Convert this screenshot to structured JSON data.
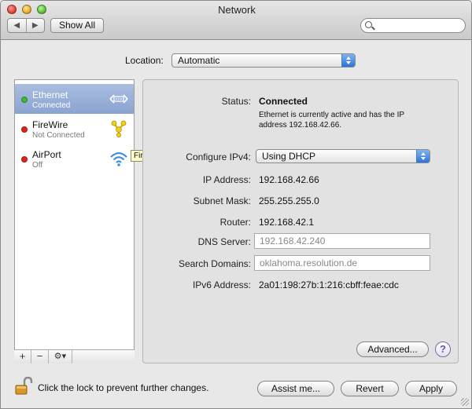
{
  "window": {
    "title": "Network"
  },
  "toolbar": {
    "back": "◀",
    "forward": "▶",
    "show_all": "Show All",
    "search_placeholder": ""
  },
  "location": {
    "label": "Location:",
    "value": "Automatic"
  },
  "services": [
    {
      "name": "Ethernet",
      "status": "Connected",
      "status_color": "#3dbb2f",
      "icon": "ethernet-icon",
      "selected": true
    },
    {
      "name": "FireWire",
      "status": "Not Connected",
      "status_color": "#e2231a",
      "icon": "firewire-icon",
      "selected": false
    },
    {
      "name": "AirPort",
      "status": "Off",
      "status_color": "#e2231a",
      "icon": "airport-wifi-icon",
      "selected": false
    }
  ],
  "tooltip": "FireWire",
  "list_controls": {
    "add": "+",
    "remove": "−",
    "gear": "⚙▾"
  },
  "detail": {
    "status_label": "Status:",
    "status_value": "Connected",
    "status_desc_line1": "Ethernet is currently active and has the IP",
    "status_desc_line2": "address 192.168.42.66.",
    "configure_label": "Configure IPv4:",
    "configure_value": "Using DHCP",
    "ip_label": "IP Address:",
    "ip_value": "192.168.42.66",
    "subnet_label": "Subnet Mask:",
    "subnet_value": "255.255.255.0",
    "router_label": "Router:",
    "router_value": "192.168.42.1",
    "dns_label": "DNS Server:",
    "dns_value": "192.168.42.240",
    "search_domains_label": "Search Domains:",
    "search_domains_value": "oklahoma.resolution.de",
    "ipv6_label": "IPv6 Address:",
    "ipv6_value": "2a01:198:27b:1:216:cbff:feae:cdc",
    "advanced": "Advanced...",
    "help": "?"
  },
  "footer": {
    "lock_text": "Click the lock to prevent further changes.",
    "assist": "Assist me...",
    "revert": "Revert",
    "apply": "Apply"
  }
}
